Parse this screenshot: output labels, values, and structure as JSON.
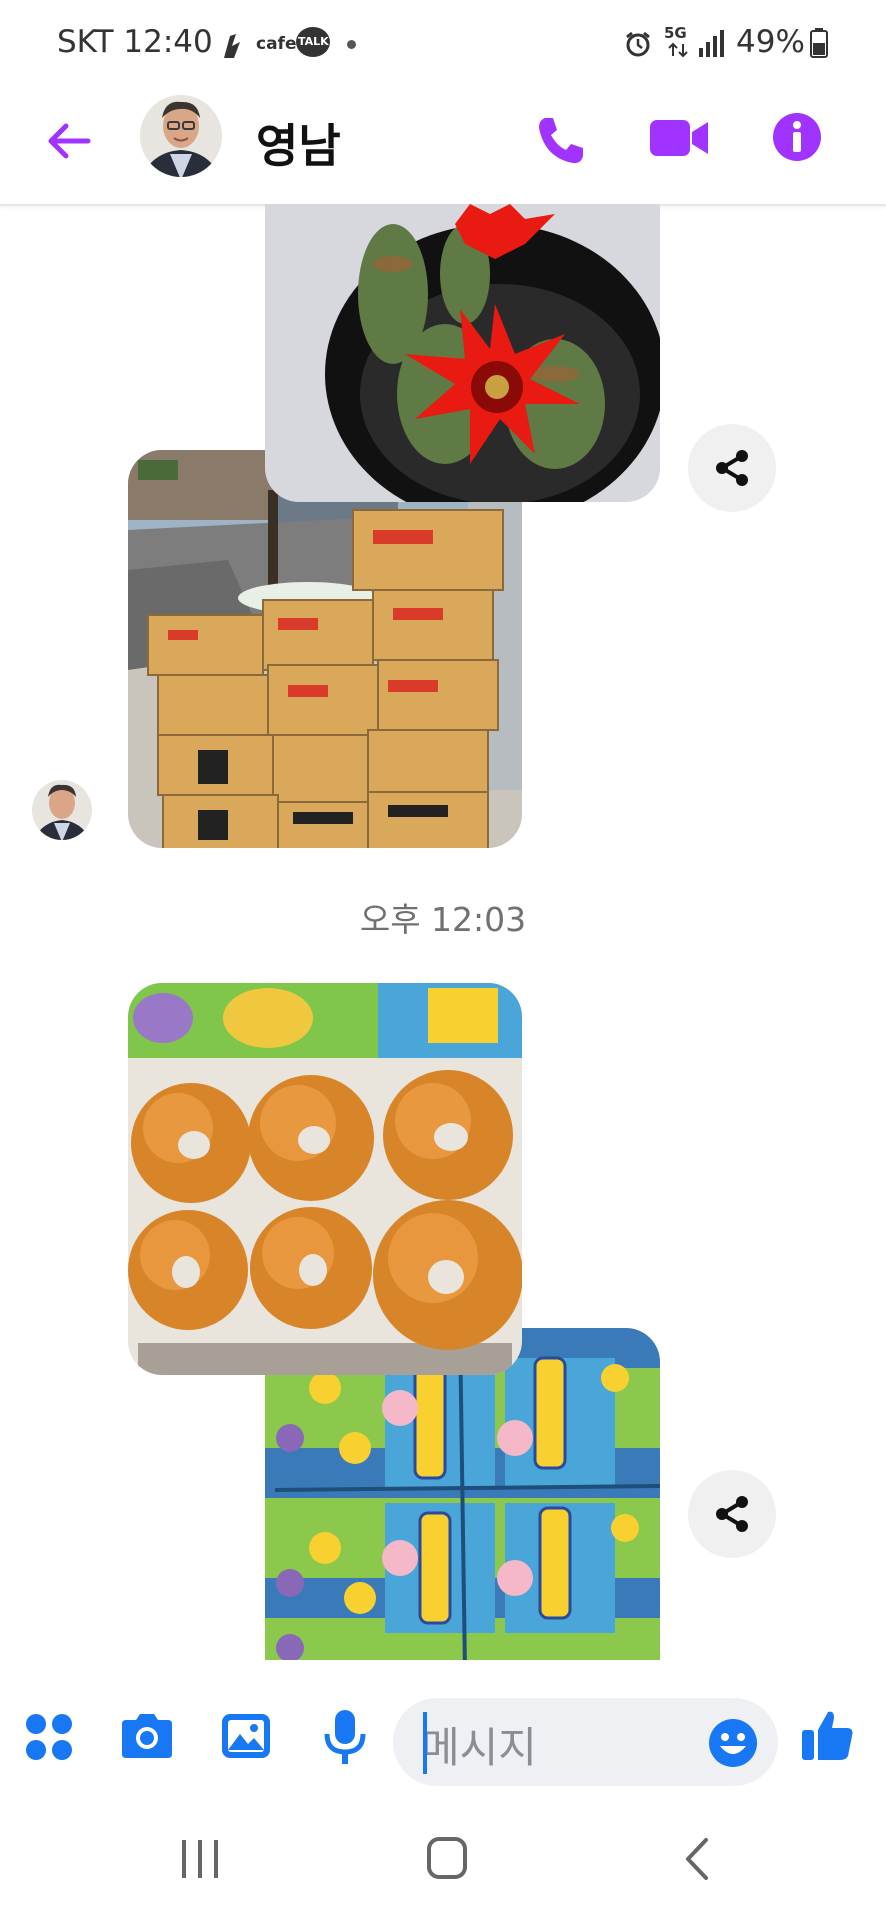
{
  "status_bar": {
    "carrier_time": "SKT 12:40",
    "cafe_label": "cafe",
    "talk_label": "TALK",
    "network": "5G",
    "battery": "49%"
  },
  "header": {
    "contact_name": "영남",
    "icons": [
      "back-arrow-icon",
      "phone-icon",
      "video-camera-icon",
      "info-icon"
    ],
    "accent_color": "#a033ff"
  },
  "thread": {
    "timestamp": "오후 12:03",
    "photos": [
      {
        "name": "cactus-flower-photo"
      },
      {
        "name": "ramen-boxes-photo"
      },
      {
        "name": "glazed-donuts-photo"
      },
      {
        "name": "pokemon-boxes-photo"
      }
    ]
  },
  "composer": {
    "placeholder": "메시지",
    "icons": [
      "menu-dots-icon",
      "camera-icon",
      "gallery-icon",
      "microphone-icon",
      "emoji-icon",
      "like-icon"
    ],
    "accent_color": "#1877f2"
  },
  "nav_bar": {
    "icons": [
      "recent-apps-icon",
      "home-icon",
      "back-icon"
    ]
  }
}
